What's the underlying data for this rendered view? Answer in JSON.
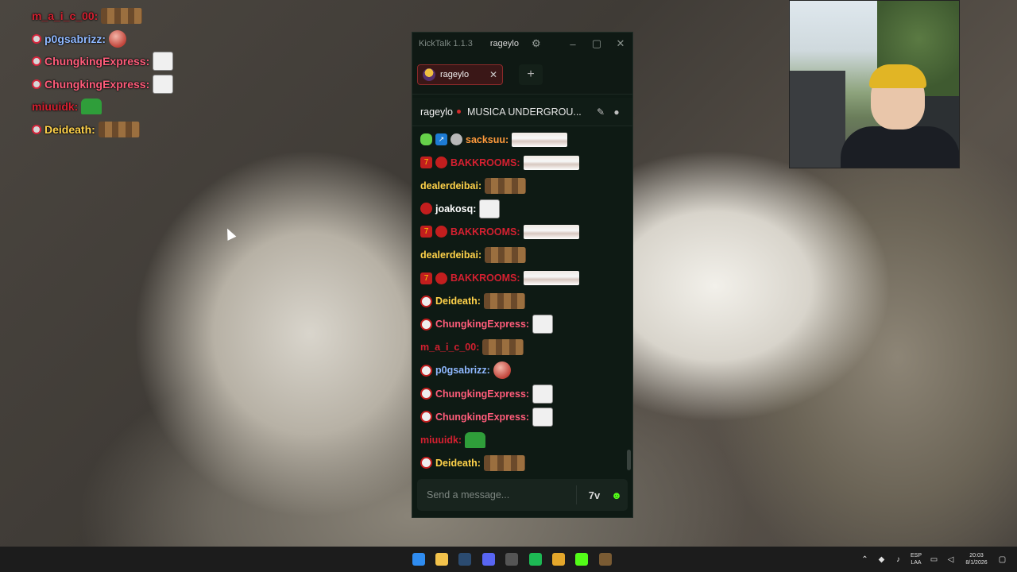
{
  "overlay_chat": [
    {
      "name": "m_a_i_c_00:",
      "color": "#d42030",
      "badge": false,
      "emote": "monkeys"
    },
    {
      "name": "p0gsabrizz:",
      "color": "#8fb8ff",
      "badge": true,
      "emote": "ball"
    },
    {
      "name": "ChungkingExpress:",
      "color": "#ff5c7a",
      "badge": true,
      "emote": "sketch"
    },
    {
      "name": "ChungkingExpress:",
      "color": "#ff5c7a",
      "badge": true,
      "emote": "sketch"
    },
    {
      "name": "miuuidk:",
      "color": "#d42030",
      "badge": false,
      "emote": "green"
    },
    {
      "name": "Deideath:",
      "color": "#ffd24a",
      "badge": true,
      "emote": "monkeys"
    }
  ],
  "kicktalk": {
    "app_name": "KickTalk 1.1.3",
    "title_channel": "rageylo",
    "tab_label": "rageylo",
    "channel_name": "rageylo",
    "stream_title": "MUSICA UNDERGROU...",
    "input_placeholder": "Send a message...",
    "messages": [
      {
        "name": "sacksuu:",
        "color": "#ff9a3c",
        "badges": [
          "green",
          "blue",
          "silver"
        ],
        "emote": "face"
      },
      {
        "name": "BAKKROOMS:",
        "color": "#d42030",
        "badges": [
          "redsq",
          "red"
        ],
        "emote": "face"
      },
      {
        "name": "dealerdeibai:",
        "color": "#ffd24a",
        "badges": [],
        "emote": "monkeys"
      },
      {
        "name": "joakosq:",
        "color": "#ffffff",
        "badges": [
          "red"
        ],
        "emote": "sketch"
      },
      {
        "name": "BAKKROOMS:",
        "color": "#d42030",
        "badges": [
          "redsq",
          "red"
        ],
        "emote": "face"
      },
      {
        "name": "dealerdeibai:",
        "color": "#ffd24a",
        "badges": [],
        "emote": "monkeys"
      },
      {
        "name": "BAKKROOMS:",
        "color": "#d42030",
        "badges": [
          "redsq",
          "red"
        ],
        "emote": "face"
      },
      {
        "name": "Deideath:",
        "color": "#ffd24a",
        "badges": [
          "grey"
        ],
        "emote": "monkeys"
      },
      {
        "name": "ChungkingExpress:",
        "color": "#ff5c7a",
        "badges": [
          "grey"
        ],
        "emote": "sketch"
      },
      {
        "name": "m_a_i_c_00:",
        "color": "#d42030",
        "badges": [],
        "emote": "monkeys"
      },
      {
        "name": "p0gsabrizz:",
        "color": "#8fb8ff",
        "badges": [
          "grey"
        ],
        "emote": "ball"
      },
      {
        "name": "ChungkingExpress:",
        "color": "#ff5c7a",
        "badges": [
          "grey"
        ],
        "emote": "sketch"
      },
      {
        "name": "ChungkingExpress:",
        "color": "#ff5c7a",
        "badges": [
          "grey"
        ],
        "emote": "sketch"
      },
      {
        "name": "miuuidk:",
        "color": "#d42030",
        "badges": [],
        "emote": "green"
      },
      {
        "name": "Deideath:",
        "color": "#ffd24a",
        "badges": [
          "grey"
        ],
        "emote": "monkeys"
      }
    ]
  },
  "taskbar": {
    "apps": [
      {
        "name": "windows-start-icon",
        "color": "#2f8cf0"
      },
      {
        "name": "file-explorer-icon",
        "color": "#f2c24b"
      },
      {
        "name": "steam-icon",
        "color": "#2b4b70"
      },
      {
        "name": "discord-icon",
        "color": "#5865f2"
      },
      {
        "name": "obs-icon",
        "color": "#555555"
      },
      {
        "name": "spotify-icon",
        "color": "#1db954"
      },
      {
        "name": "chrome-icon",
        "color": "#e4a72b"
      },
      {
        "name": "kick-icon",
        "color": "#53fc18"
      },
      {
        "name": "minecraft-icon",
        "color": "#7a5b33"
      }
    ],
    "lang_top": "ESP",
    "lang_bottom": "LAA",
    "time": "20:03",
    "date": "8/1/2026"
  }
}
